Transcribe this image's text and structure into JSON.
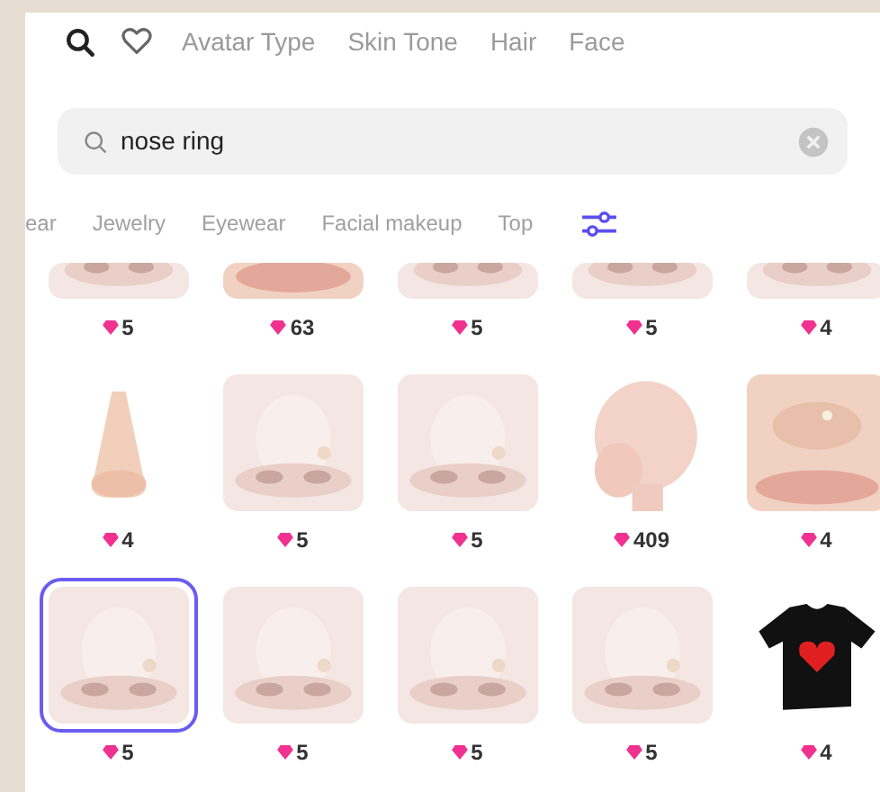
{
  "top_tabs": [
    "Avatar Type",
    "Skin Tone",
    "Hair",
    "Face"
  ],
  "search": {
    "value": "nose ring"
  },
  "categories": [
    "ear",
    "Jewelry",
    "Eyewear",
    "Facial makeup",
    "Top"
  ],
  "rows": [
    {
      "items": [
        {
          "kind": "nose",
          "price": "5",
          "selected": false
        },
        {
          "kind": "lips",
          "price": "63",
          "selected": false
        },
        {
          "kind": "nose",
          "price": "5",
          "selected": false
        },
        {
          "kind": "nose",
          "price": "5",
          "selected": false
        },
        {
          "kind": "nose",
          "price": "4",
          "selected": false
        }
      ]
    },
    {
      "items": [
        {
          "kind": "plain-nose",
          "price": "4",
          "selected": false
        },
        {
          "kind": "nose",
          "price": "5",
          "selected": false
        },
        {
          "kind": "nose",
          "price": "5",
          "selected": false
        },
        {
          "kind": "head",
          "price": "409",
          "selected": false
        },
        {
          "kind": "lips",
          "price": "4",
          "selected": false
        }
      ]
    },
    {
      "items": [
        {
          "kind": "nose",
          "price": "5",
          "selected": true
        },
        {
          "kind": "nose",
          "price": "5",
          "selected": false
        },
        {
          "kind": "nose",
          "price": "5",
          "selected": false
        },
        {
          "kind": "nose",
          "price": "5",
          "selected": false
        },
        {
          "kind": "shirt",
          "price": "4",
          "selected": false
        }
      ]
    }
  ]
}
